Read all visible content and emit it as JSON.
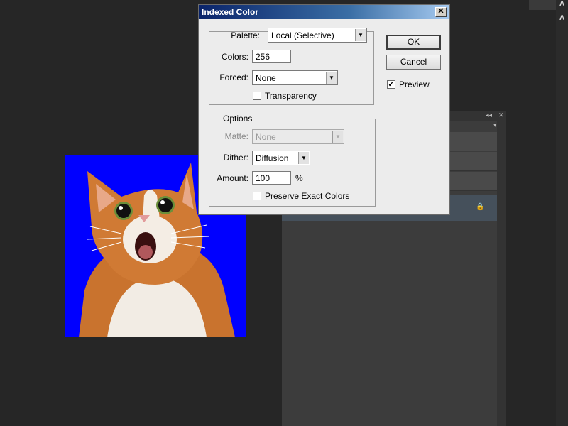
{
  "dialog": {
    "title": "Indexed Color",
    "close_glyph": "✕",
    "palette_label": "Palette:",
    "palette_value": "Local (Selective)",
    "colors_label": "Colors:",
    "colors_value": "256",
    "forced_label": "Forced:",
    "forced_value": "None",
    "transparency_label": "Transparency",
    "transparency_checked": false,
    "options_legend": "Options",
    "matte_label": "Matte:",
    "matte_value": "None",
    "dither_label": "Dither:",
    "dither_value": "Diffusion",
    "amount_label": "Amount:",
    "amount_value": "100",
    "amount_unit": "%",
    "preserve_label": "Preserve Exact Colors",
    "preserve_checked": false,
    "ok_label": "OK",
    "cancel_label": "Cancel",
    "preview_label": "Preview",
    "preview_checked": true
  },
  "background": {
    "panel_letters": [
      "A",
      "A"
    ],
    "layer_fill": "#0000ff"
  },
  "icons": {
    "dropdown_arrow": "▼",
    "check": "✓",
    "lock": "🔒",
    "collapse": "◂◂",
    "close": "✕",
    "menu": "▾≡"
  }
}
